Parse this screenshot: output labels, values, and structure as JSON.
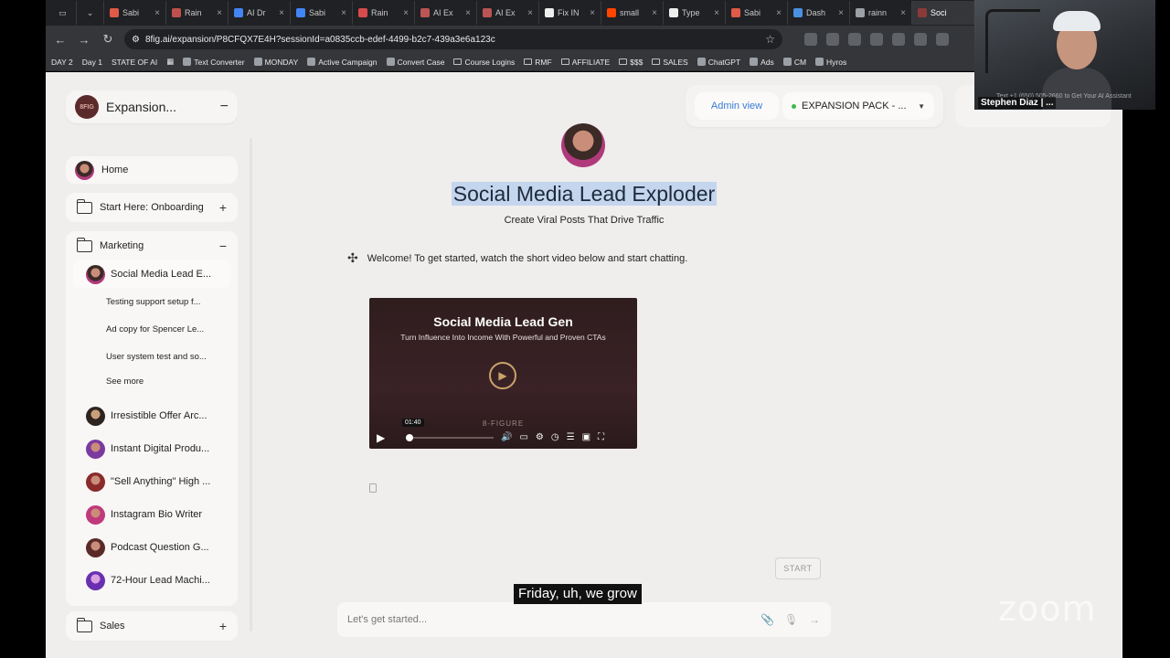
{
  "browser": {
    "tabs": [
      "Sabi",
      "Rain",
      "AI Dr",
      "Sabi",
      "Rain",
      "AI Ex",
      "AI Ex",
      "Fix IN",
      "small",
      "Type",
      "Sabi",
      "Dash",
      "rainn",
      "Soci"
    ],
    "url": "8fig.ai/expansion/P8CFQX7E4H?sessionId=a0835ccb-edef-4499-b2c7-439a3e6a123c",
    "bookmarks": [
      "DAY 2",
      "Day 1",
      "STATE OF AI",
      "Text Converter",
      "MONDAY",
      "Active Campaign",
      "Convert Case",
      "Course Logins",
      "RMF",
      "AFFILIATE",
      "$$$",
      "SALES",
      "ChatGPT",
      "Ads",
      "CM",
      "Hyros"
    ]
  },
  "sidebar": {
    "brand": "Expansion...",
    "brand_logo": "8FIG",
    "home": "Home",
    "onboarding": "Start Here: Onboarding",
    "marketing": {
      "label": "Marketing",
      "current": "Social Media Lead E...",
      "sessions": [
        "Testing support setup f...",
        "Ad copy for Spencer Le...",
        "User system test and so..."
      ],
      "see_more": "See more"
    },
    "assistants": [
      "Irresistible Offer Arc...",
      "Instant Digital Produ...",
      "\"Sell Anything\" High ...",
      "Instagram Bio Writer",
      "Podcast Question G...",
      "72-Hour Lead Machi..."
    ],
    "sales": "Sales"
  },
  "topbar": {
    "admin": "Admin view",
    "pack": "EXPANSION PACK - ..."
  },
  "main": {
    "title": "Social Media Lead Exploder",
    "subtitle": "Create Viral Posts That Drive Traffic",
    "welcome": "Welcome! To get started, watch the short video below and start chatting.",
    "video": {
      "title": "Social Media Lead Gen",
      "subtitle": "Turn Influence Into Income With Powerful and Proven CTAs",
      "brand": "8-FIGURE",
      "time": "01:40"
    },
    "start": "START",
    "chat_placeholder": "Let's get started..."
  },
  "overlay": {
    "caption": "Friday, uh, we grow",
    "zoom": "zoom",
    "cam_name": "Stephen Diaz | ...",
    "cam_text": "Text +1 (650) 505-2660 to Get Your AI Assistant"
  },
  "colors": {
    "accent": "#3a7bd5",
    "highlight": "#c4d5ee",
    "status": "#3fb950"
  }
}
